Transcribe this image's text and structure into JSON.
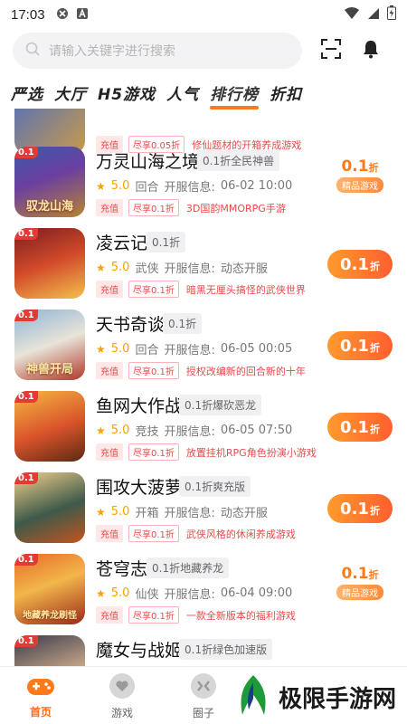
{
  "status_bar": {
    "time": "17:03"
  },
  "search": {
    "placeholder": "请输入关键字进行搜索"
  },
  "tabs": [
    {
      "label": "严选"
    },
    {
      "label": "大厅"
    },
    {
      "label": "H5游戏"
    },
    {
      "label": "人气"
    },
    {
      "label": "排行榜"
    },
    {
      "label": "折扣"
    }
  ],
  "partial_top": {
    "pill_a": "充值",
    "pill_b": "尽享0.05折",
    "desc": "修仙题材的开箱养成游戏"
  },
  "games": [
    {
      "name": "万灵山海之境",
      "tag": "0.1折全民神兽",
      "rating": "5.0",
      "genre": "回合",
      "open_label": "开服信息:",
      "open_info": "06-02 10:00",
      "pill_a": "充值",
      "pill_b": "尽享0.1折",
      "desc": "3D国韵MMORPG手游",
      "icon_caption": "驭龙山海",
      "discount": "0.1",
      "discount_unit": "折",
      "discount_style": "stamp",
      "stamp_text": "精品游戏"
    },
    {
      "name": "凌云记",
      "tag": "0.1折",
      "rating": "5.0",
      "genre": "武侠",
      "open_label": "开服信息:",
      "open_info": "动态开服",
      "pill_a": "充值",
      "pill_b": "尽享0.1折",
      "desc": "暗黑无厘头搞怪的武侠世界",
      "icon_caption": "",
      "discount": "0.1",
      "discount_unit": "折",
      "discount_style": "button"
    },
    {
      "name": "天书奇谈",
      "tag": "0.1折",
      "rating": "5.0",
      "genre": "回合",
      "open_label": "开服信息:",
      "open_info": "06-05 00:05",
      "pill_a": "充值",
      "pill_b": "尽享0.1折",
      "desc": "授权改编新的回合新的十年",
      "icon_caption": "神兽开局",
      "discount": "0.1",
      "discount_unit": "折",
      "discount_style": "button"
    },
    {
      "name": "鱼网大作战",
      "tag": "0.1折爆砍恶龙",
      "rating": "5.0",
      "genre": "竞技",
      "open_label": "开服信息:",
      "open_info": "06-05 07:50",
      "pill_a": "充值",
      "pill_b": "尽享0.1折",
      "desc": "放置挂机RPG角色扮演小游戏",
      "icon_caption": "",
      "discount": "0.1",
      "discount_unit": "折",
      "discount_style": "button"
    },
    {
      "name": "围攻大菠萝",
      "tag": "0.1折爽充版",
      "rating": "5.0",
      "genre": "开箱",
      "open_label": "开服信息:",
      "open_info": "动态开服",
      "pill_a": "充值",
      "pill_b": "尽享0.1折",
      "desc": "武侠风格的休闲养成游戏",
      "icon_caption": "",
      "discount": "0.1",
      "discount_unit": "折",
      "discount_style": "button"
    },
    {
      "name": "苍穹志",
      "tag": "0.1折地藏养龙",
      "rating": "5.0",
      "genre": "仙侠",
      "open_label": "开服信息:",
      "open_info": "06-04 09:00",
      "pill_a": "充值",
      "pill_b": "尽享0.1折",
      "desc": "一款全新版本的福利游戏",
      "icon_caption": "地藏养龙刷怪",
      "discount": "0.1",
      "discount_unit": "折",
      "discount_style": "stamp",
      "stamp_text": "精品游戏"
    },
    {
      "name": "魔女与战姬",
      "tag": "0.1折绿色加速版",
      "rating": "",
      "genre": "",
      "open_label": "",
      "open_info": "",
      "pill_a": "",
      "pill_b": "",
      "desc": "",
      "icon_caption": "",
      "discount": "",
      "discount_unit": "",
      "discount_style": "none"
    }
  ],
  "bottom_nav": [
    {
      "label": "首页"
    },
    {
      "label": "游戏"
    },
    {
      "label": "圈子"
    }
  ],
  "watermark": {
    "text": "极限手游网"
  },
  "colors": {
    "accent": "#ff7a1a",
    "discount_red": "#e84a4a",
    "star": "#f7a300"
  }
}
